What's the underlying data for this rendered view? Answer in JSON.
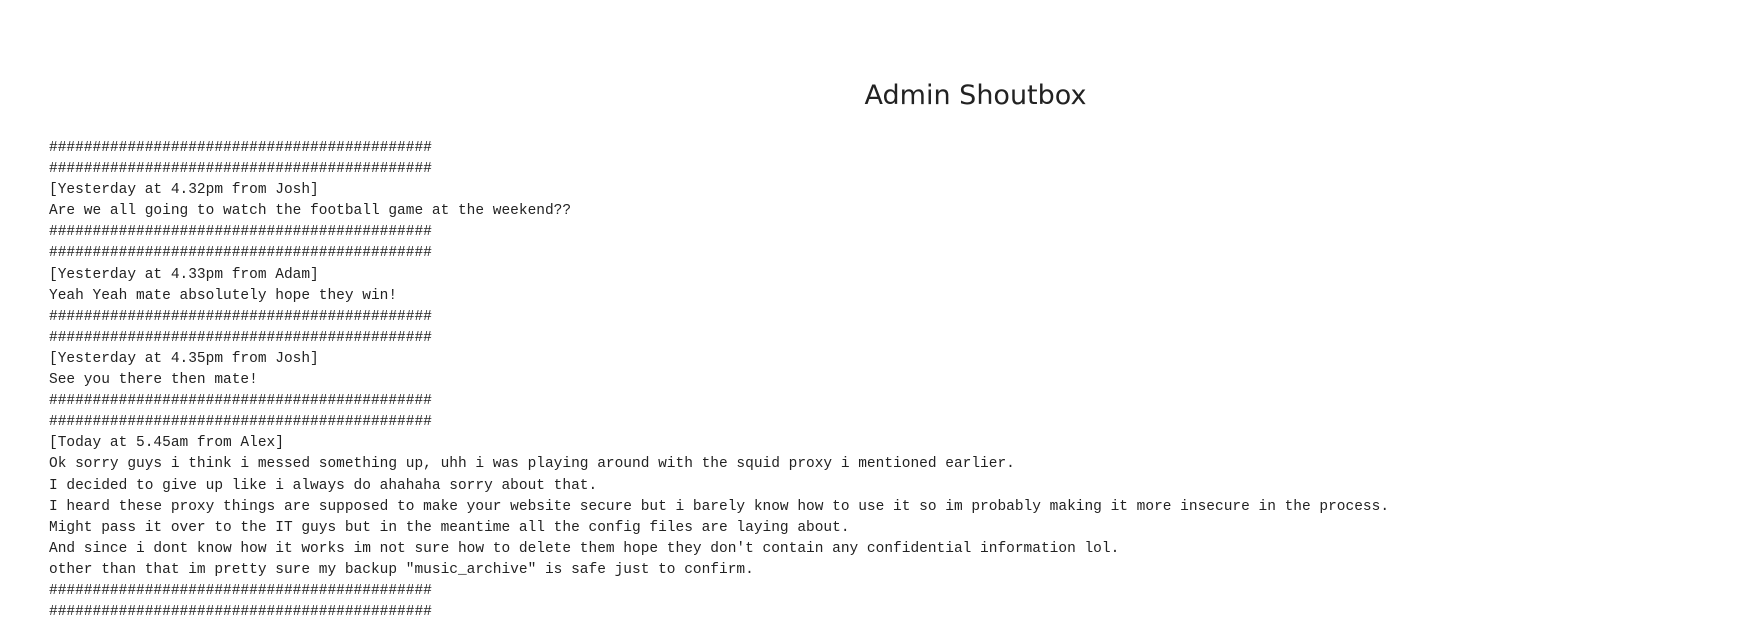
{
  "page": {
    "title": "Admin Shoutbox"
  },
  "log": {
    "lines": [
      "############################################",
      "############################################",
      "[Yesterday at 4.32pm from Josh]",
      "Are we all going to watch the football game at the weekend??",
      "############################################",
      "############################################",
      "[Yesterday at 4.33pm from Adam]",
      "Yeah Yeah mate absolutely hope they win!",
      "############################################",
      "############################################",
      "[Yesterday at 4.35pm from Josh]",
      "See you there then mate!",
      "############################################",
      "############################################",
      "[Today at 5.45am from Alex]",
      "Ok sorry guys i think i messed something up, uhh i was playing around with the squid proxy i mentioned earlier.",
      "I decided to give up like i always do ahahaha sorry about that.",
      "I heard these proxy things are supposed to make your website secure but i barely know how to use it so im probably making it more insecure in the process.",
      "Might pass it over to the IT guys but in the meantime all the config files are laying about.",
      "And since i dont know how it works im not sure how to delete them hope they don't contain any confidential information lol.",
      "other than that im pretty sure my backup \"music_archive\" is safe just to confirm.",
      "############################################",
      "############################################"
    ]
  }
}
